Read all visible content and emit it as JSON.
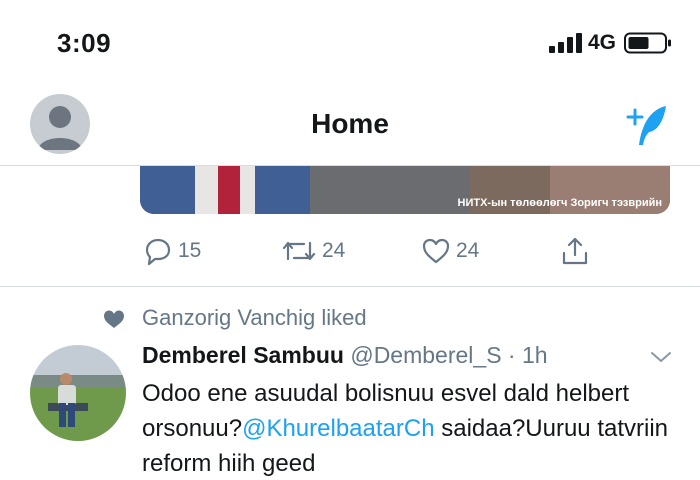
{
  "status_bar": {
    "time": "3:09",
    "network": "4G",
    "battery_icon": "battery-icon",
    "signal_icon": "signal-icon"
  },
  "nav": {
    "title": "Home",
    "compose_icon": "compose-tweet-icon",
    "avatar_icon": "default-avatar-icon"
  },
  "prev_tweet": {
    "media_caption": "НИТХ-ын төлөөлөгч Зоригч тэзврийн",
    "actions": {
      "replies": "15",
      "retweets": "24",
      "likes": "24",
      "share_icon": "share-icon"
    }
  },
  "tweet": {
    "social_context": "Ganzorig Vanchig liked",
    "author_name": "Demberel Sambuu",
    "author_handle": "@Demberel_S",
    "separator": " · ",
    "time": "1h",
    "text_part1": "Odoo ene asuudal bolisnuu esvel dald helbert orsonuu?",
    "mention": "@KhurelbaatarCh",
    "text_part2": " saidaa?Uuruu tatvriin reform hiih geed"
  },
  "colors": {
    "accent": "#1da1f2",
    "secondary_text": "#657786",
    "divider": "#d8dde2"
  }
}
